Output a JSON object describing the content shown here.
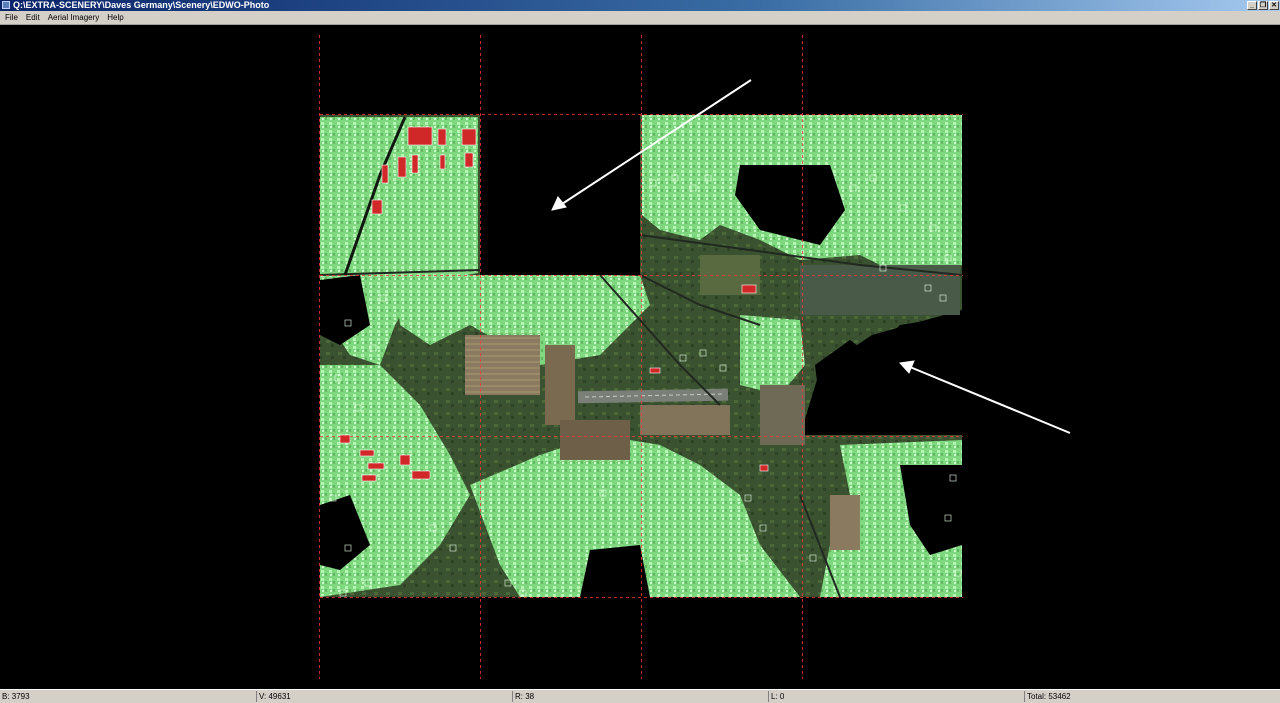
{
  "window": {
    "title": "Q:\\EXTRA-SCENERY\\Daves Germany\\Scenery\\EDWO-Photo",
    "controls": [
      "minimize",
      "restore",
      "close"
    ]
  },
  "menu": {
    "items": [
      {
        "label": "File"
      },
      {
        "label": "Edit"
      },
      {
        "label": "Aerial Imagery"
      },
      {
        "label": "Help"
      }
    ]
  },
  "viewport": {
    "background": "#000000",
    "tile_grid_color": "#ff3333",
    "vegetation_color": "#8ee88e",
    "building_color": "#e03030",
    "terrain_color": "#3d5530",
    "annotation_arrow_color": "#ffffff"
  },
  "status": {
    "b": "B: 3793",
    "v": "V: 49631",
    "r": "R: 38",
    "l": "L: 0",
    "total": "Total: 53462"
  }
}
